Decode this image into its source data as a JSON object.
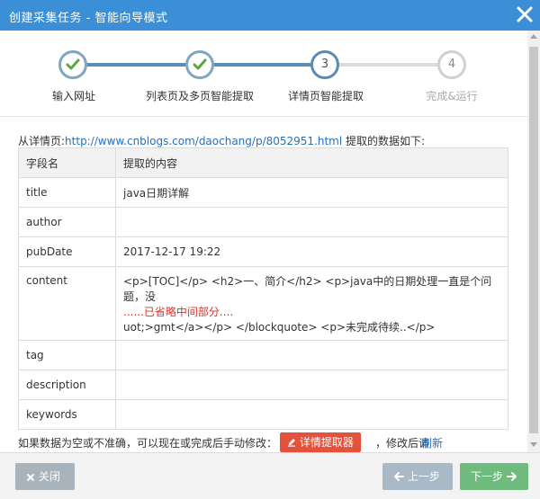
{
  "window": {
    "title": "创建采集任务 - 智能向导模式"
  },
  "steps": [
    {
      "num": "✓",
      "label": "输入网址",
      "state": "done"
    },
    {
      "num": "✓",
      "label": "列表页及多页智能提取",
      "state": "done"
    },
    {
      "num": "3",
      "label": "详情页智能提取",
      "state": "current"
    },
    {
      "num": "4",
      "label": "完成&运行",
      "state": "future"
    }
  ],
  "source": {
    "prefix": "从详情页:",
    "url": "http://www.cnblogs.com/daochang/p/8052951.html",
    "suffix": " 提取的数据如下:"
  },
  "table": {
    "headers": [
      "字段名",
      "提取的内容"
    ],
    "rows": [
      {
        "name": "title",
        "value": "java日期详解"
      },
      {
        "name": "author",
        "value": ""
      },
      {
        "name": "pubDate",
        "value": "2017-12-17 19:22"
      },
      {
        "name": "content",
        "line1": "<p>[TOC]</p> <h2>一、简介</h2> <p>java中的日期处理一直是个问题，没",
        "omitted": "......已省略中间部分....",
        "line2": "uot;>gmt</a></p> </blockquote> <p>未完成待续..</p>"
      },
      {
        "name": "tag",
        "value": ""
      },
      {
        "name": "description",
        "value": ""
      },
      {
        "name": "keywords",
        "value": ""
      }
    ]
  },
  "hint": {
    "text_before": "如果数据为空或不准确，可以现在或完成后手动修改：",
    "editor_button": "详情提取器",
    "text_after": "，修改后请",
    "refresh_link": "刷新"
  },
  "footer": {
    "close_label": "关闭",
    "prev_label": "上一步",
    "next_label": "下一步"
  },
  "colors": {
    "titlebar": "#3a8fd6",
    "progress_done": "#5b8bb2",
    "accent_red": "#e4523b",
    "next_green": "#6fbb7e",
    "check_green": "#5aa642"
  }
}
